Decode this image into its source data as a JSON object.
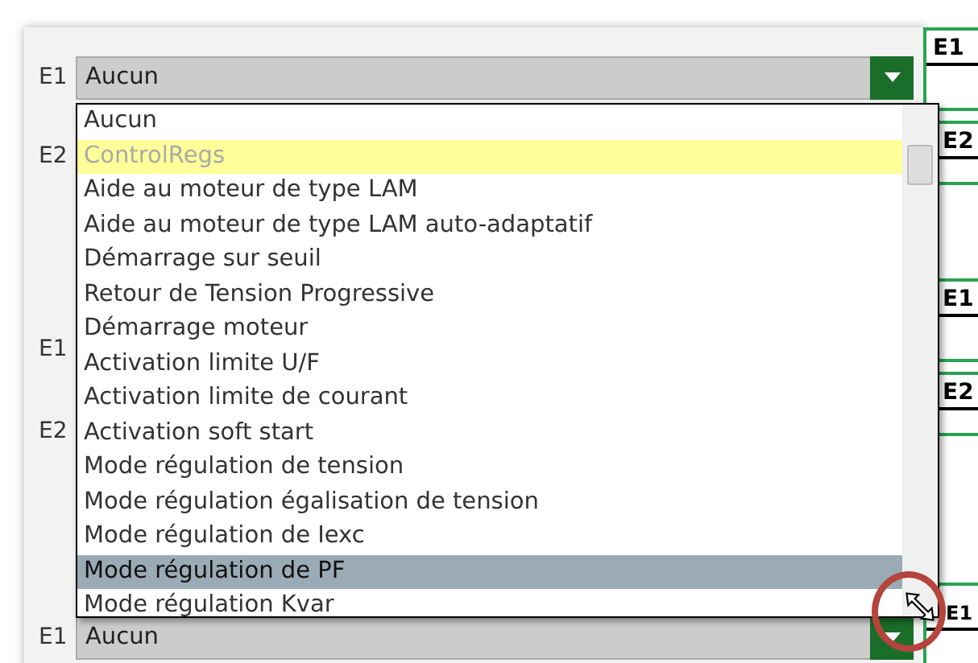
{
  "fields": [
    {
      "label": "E1",
      "kind": "select",
      "value": "Aucun"
    },
    {
      "label": "E2",
      "kind": "label"
    },
    {
      "label": "E1",
      "kind": "label"
    },
    {
      "label": "E2",
      "kind": "label"
    },
    {
      "label": "E1",
      "kind": "select",
      "value": "Aucun"
    }
  ],
  "dropdown": {
    "items": [
      {
        "label": "Aucun",
        "kind": "option",
        "selected": false
      },
      {
        "label": "ControlRegs",
        "kind": "group",
        "selected": false
      },
      {
        "label": "Aide au moteur de type LAM",
        "kind": "option",
        "selected": false
      },
      {
        "label": "Aide au moteur de type LAM auto-adaptatif",
        "kind": "option",
        "selected": false
      },
      {
        "label": "Démarrage sur seuil",
        "kind": "option",
        "selected": false
      },
      {
        "label": "Retour de Tension Progressive",
        "kind": "option",
        "selected": false
      },
      {
        "label": "Démarrage moteur",
        "kind": "option",
        "selected": false
      },
      {
        "label": "Activation limite U/F",
        "kind": "option",
        "selected": false
      },
      {
        "label": "Activation limite de courant",
        "kind": "option",
        "selected": false
      },
      {
        "label": "Activation soft start",
        "kind": "option",
        "selected": false
      },
      {
        "label": "Mode régulation de tension",
        "kind": "option",
        "selected": false
      },
      {
        "label": "Mode régulation égalisation de tension",
        "kind": "option",
        "selected": false
      },
      {
        "label": "Mode régulation de Iexc",
        "kind": "option",
        "selected": false
      },
      {
        "label": "Mode régulation de PF",
        "kind": "option",
        "selected": true
      },
      {
        "label": "Mode régulation Kvar",
        "kind": "option",
        "selected": false
      }
    ]
  },
  "side_blocks": [
    "E1",
    "E2",
    "E1",
    "E2",
    "E1"
  ]
}
